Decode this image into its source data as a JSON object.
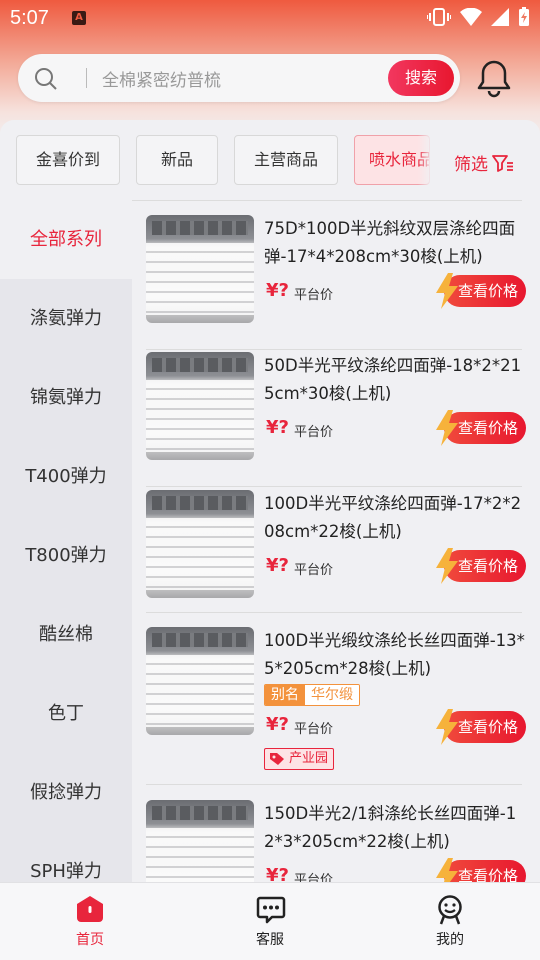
{
  "status_bar": {
    "time": "5:07",
    "app_badge": "A"
  },
  "search": {
    "placeholder": "全棉紧密纺普梳",
    "button_label": "搜索"
  },
  "category_tabs": [
    {
      "label": "金喜价到",
      "active": false
    },
    {
      "label": "新品",
      "active": false
    },
    {
      "label": "主营商品",
      "active": false
    },
    {
      "label": "喷水商品",
      "active": true
    }
  ],
  "filter_label": "筛选",
  "sidebar": {
    "items": [
      {
        "label": "全部系列",
        "active": true
      },
      {
        "label": "涤氨弹力",
        "active": false
      },
      {
        "label": "锦氨弹力",
        "active": false
      },
      {
        "label": "T400弹力",
        "active": false
      },
      {
        "label": "T800弹力",
        "active": false
      },
      {
        "label": "酷丝棉",
        "active": false
      },
      {
        "label": "色丁",
        "active": false
      },
      {
        "label": "假捻弹力",
        "active": false
      },
      {
        "label": "SPH弹力",
        "active": false
      }
    ]
  },
  "products": [
    {
      "title": "75D*100D半光斜纹双层涤纶四面弹-17*4*208cm*30梭(上机)",
      "price_symbol": "¥?",
      "price_label": "平台价",
      "button": "查看价格"
    },
    {
      "title": "50D半光平纹涤纶四面弹-18*2*215cm*30梭(上机)",
      "price_symbol": "¥?",
      "price_label": "平台价",
      "button": "查看价格"
    },
    {
      "title": "100D半光平纹涤纶四面弹-17*2*208cm*22梭(上机)",
      "price_symbol": "¥?",
      "price_label": "平台价",
      "button": "查看价格"
    },
    {
      "title": "100D半光缎纹涤纶长丝四面弹-13*5*205cm*28梭(上机)",
      "alias_key": "别名",
      "alias_value": "华尔缎",
      "price_symbol": "¥?",
      "price_label": "平台价",
      "button": "查看价格",
      "tag": "产业园"
    },
    {
      "title": "150D半光2/1斜涤纶长丝四面弹-12*3*205cm*22梭(上机)",
      "price_symbol": "¥?",
      "price_label": "平台价",
      "button": "查看价格"
    }
  ],
  "bottom_nav": [
    {
      "label": "首页",
      "icon": "home-icon",
      "active": true
    },
    {
      "label": "客服",
      "icon": "chat-icon",
      "active": false
    },
    {
      "label": "我的",
      "icon": "profile-icon",
      "active": false
    }
  ],
  "colors": {
    "accent": "#e8253c",
    "orange": "#f3923c",
    "hero_top": "#ef5a3f"
  }
}
